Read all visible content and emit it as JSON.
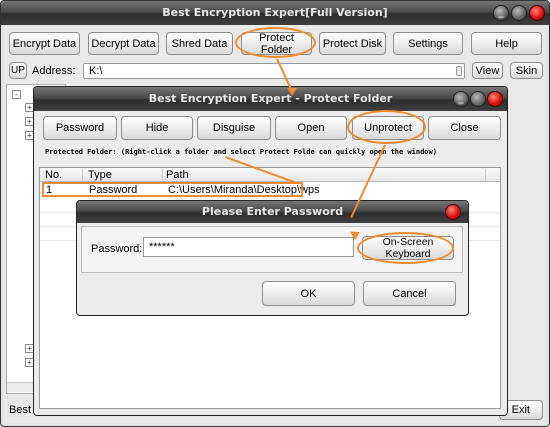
{
  "main_window": {
    "title": "Best Encryption Expert[Full Version]",
    "toolbar": [
      "Encrypt Data",
      "Decrypt Data",
      "Shred Data",
      "Protect Folder",
      "Protect Disk",
      "Settings",
      "Help"
    ],
    "up_label": "UP",
    "address_label": "Address:",
    "address_value": "K:\\",
    "view_label": "View",
    "skin_label": "Skin",
    "status_left": "Best E",
    "exit_label": "Exit"
  },
  "protect_window": {
    "title": "Best Encryption Expert - Protect Folder",
    "buttons": [
      "Password",
      "Hide",
      "Disguise",
      "Open",
      "Unprotect",
      "Close"
    ],
    "hint": "Protected Folder: (Right-click a folder and select  Protect Folde  can quickly open the window)",
    "columns": [
      "No.",
      "Type",
      "Path"
    ],
    "rows": [
      {
        "no": "1",
        "type": "Password",
        "path": "C:\\Users\\Miranda\\Desktop\\wps"
      }
    ]
  },
  "password_dialog": {
    "title": "Please Enter  Password",
    "label": "Password:",
    "value": "******",
    "keyboard_label": "On-Screen Keyboard",
    "ok_label": "OK",
    "cancel_label": "Cancel"
  },
  "colors": {
    "accent": "#f28a2e",
    "titlebar": "#3f3f3f",
    "close": "#d11111"
  }
}
